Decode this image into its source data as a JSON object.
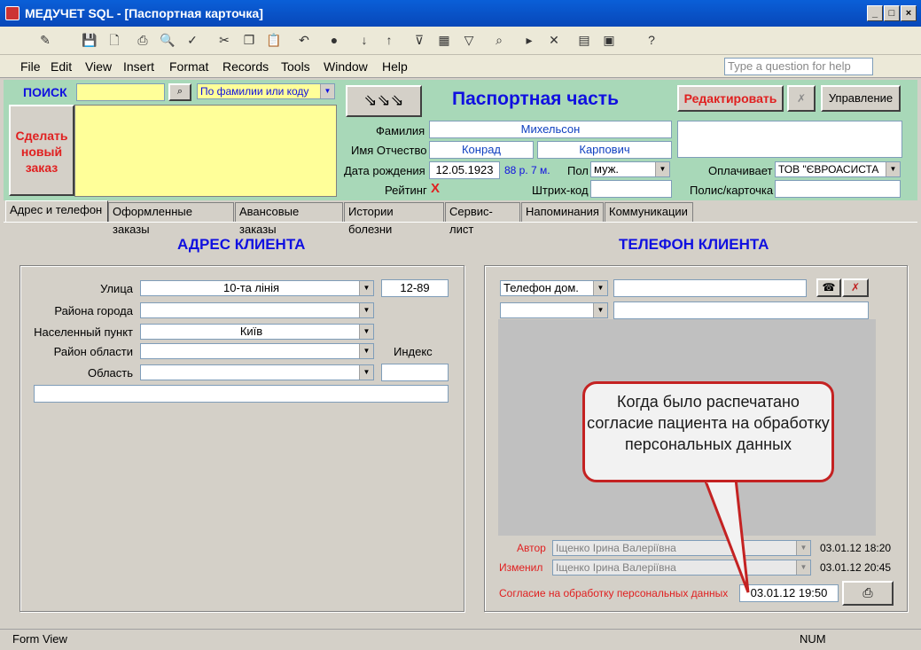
{
  "window": {
    "title": "МЕДУЧЕТ SQL - [Паспортная карточка]"
  },
  "menu": [
    "File",
    "Edit",
    "View",
    "Insert",
    "Format",
    "Records",
    "Tools",
    "Window",
    "Help"
  ],
  "ask_placeholder": "Type a question for help",
  "search": {
    "label": "ПОИСК",
    "mode": "По фамилии или коду"
  },
  "new_order": "Сделать новый заказ",
  "section_title": "Паспортная часть",
  "edit_button": "Редактировать",
  "manage_button": "Управление",
  "patient": {
    "surname_label": "Фамилия",
    "surname": "Михельсон",
    "name_label": "Имя Отчество",
    "first_name": "Конрад",
    "patronymic": "Карпович",
    "dob_label": "Дата рождения",
    "dob": "12.05.1923",
    "age": "88 р. 7 м.",
    "sex_label": "Пол",
    "sex": "муж.",
    "rating_label": "Рейтинг",
    "rating": "X",
    "barcode_label": "Штрих-код",
    "payer_label": "Оплачивает",
    "payer": "ТОВ \"ЄВРОАСИСТА",
    "policy_label": "Полис/карточка"
  },
  "tabs": [
    "Адрес и телефон",
    "Оформленные заказы",
    "Авансовые заказы",
    "Истории болезни",
    "Сервис-лист",
    "Напоминания",
    "Коммуникации"
  ],
  "address": {
    "title": "АДРЕС КЛИЕНТА",
    "street_label": "Улица",
    "street": "10-та лінія",
    "house": "12-89",
    "district_label": "Района города",
    "city_label": "Населенный пункт",
    "city": "Київ",
    "region_district_label": "Район области",
    "index_label": "Индекс",
    "region_label": "Область"
  },
  "phone": {
    "title": "ТЕЛЕФОН КЛИЕНТА",
    "type": "Телефон дом.",
    "author_label": "Автор",
    "author": "Іщенко Ірина Валеріївна",
    "author_date": "03.01.12 18:20",
    "editor_label": "Изменил",
    "editor": "Іщенко Ірина Валеріївна",
    "editor_date": "03.01.12 20:45",
    "consent_label": "Согласие на обработку персональных данных",
    "consent_date": "03.01.12 19:50"
  },
  "callout": "Когда было распечатано согласие пациента на обработку персональных данных",
  "status": {
    "left": "Form View",
    "right": "NUM"
  },
  "colors": {
    "header_bg": "#a8d8b8",
    "title_blue": "#1010e0",
    "red": "#e02020"
  }
}
